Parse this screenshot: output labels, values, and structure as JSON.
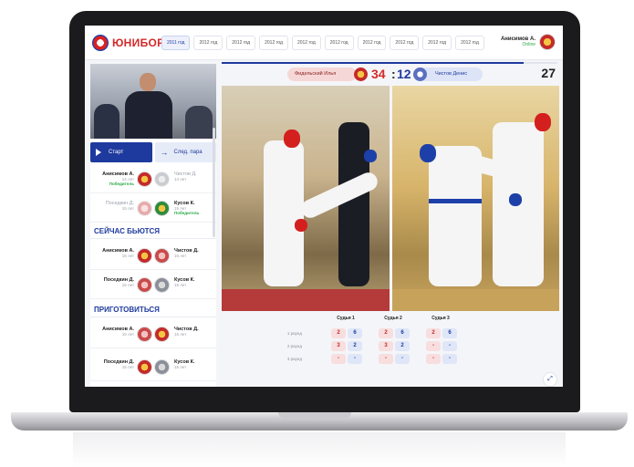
{
  "app": {
    "logo_text": "ЮНИБОР",
    "brand_red": "#d42a2a",
    "brand_blue": "#1e3a9e"
  },
  "years": [
    {
      "label": "2011 год",
      "active": true
    },
    {
      "label": "2012 год",
      "active": false
    },
    {
      "label": "2012 год",
      "active": false
    },
    {
      "label": "2012 год",
      "active": false
    },
    {
      "label": "2012 год",
      "active": false
    },
    {
      "label": "2012 год",
      "active": false
    },
    {
      "label": "2012 год",
      "active": false
    },
    {
      "label": "2012 год",
      "active": false
    },
    {
      "label": "2012 год",
      "active": false
    },
    {
      "label": "2012 год",
      "active": false
    }
  ],
  "user": {
    "name": "Анисимов А.",
    "status": "Online"
  },
  "controls": {
    "start_label": "Старт",
    "next_label": "След. пара"
  },
  "finished_matches": [
    {
      "a_name": "Анисимов А.",
      "a_age": "14 лет",
      "a_result": "Победитель",
      "b_name": "Чистов Д.",
      "b_age": "14 лет",
      "b_result": ""
    },
    {
      "a_name": "Поседкин Д.",
      "a_age": "15 лет",
      "a_result": "",
      "b_name": "Кусов К.",
      "b_age": "15 лет",
      "b_result": "Победитель"
    }
  ],
  "sections": {
    "now_fighting": "СЕЙЧАС БЬЮТСЯ",
    "get_ready": "ПРИГОТОВИТЬСЯ"
  },
  "now_matches": [
    {
      "a_name": "Анисимов А.",
      "a_age": "15 лет",
      "b_name": "Чистов Д.",
      "b_age": "15 лет"
    },
    {
      "a_name": "Поседкин Д.",
      "a_age": "15 лет",
      "b_name": "Кусов К.",
      "b_age": "15 лет"
    }
  ],
  "ready_matches": [
    {
      "a_name": "Анисимов А.",
      "a_age": "15 лет",
      "b_name": "Чистов Д.",
      "b_age": "15 лет"
    },
    {
      "a_name": "Поседкин Д.",
      "a_age": "15 лет",
      "b_name": "Кусов К.",
      "b_age": "15 лет"
    }
  ],
  "bout": {
    "red_name": "Фидельский Илья",
    "blue_name": "Чистов Денис",
    "red_score": "34",
    "separator": ":",
    "blue_score": "12",
    "timer": "27",
    "progress_percent": 90
  },
  "judges": {
    "headers": [
      "Судья 1",
      "Судья 2",
      "Судья 3"
    ],
    "rounds": [
      "1 раунд",
      "2 раунд",
      "3 раунд"
    ],
    "scores": [
      [
        [
          "2",
          "6"
        ],
        [
          "2",
          "6"
        ],
        [
          "2",
          "6"
        ]
      ],
      [
        [
          "3",
          "2"
        ],
        [
          "3",
          "2"
        ],
        [
          "-",
          "-"
        ]
      ],
      [
        [
          "-",
          "-"
        ],
        [
          "-",
          "-"
        ],
        [
          "-",
          "-"
        ]
      ]
    ]
  }
}
